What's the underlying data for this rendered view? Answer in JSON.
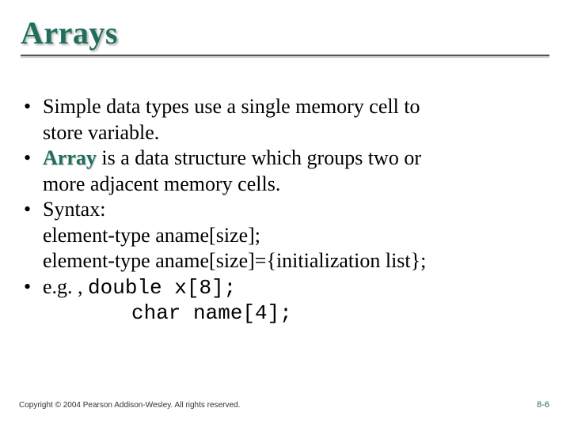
{
  "title": "Arrays",
  "bullets": [
    {
      "mark": "•",
      "line1": "Simple data types use a single memory cell to",
      "line2": "store variable."
    },
    {
      "mark": "•",
      "term": "Array",
      "line1_after": " is a data structure which groups two or",
      "line2": "more adjacent memory cells."
    },
    {
      "mark": "•",
      "line1": "Syntax:",
      "line2": "element-type aname[size];",
      "line3": "element-type aname[size]={initialization list};"
    },
    {
      "mark": "•",
      "prefix": "e.g. , ",
      "code1": "double x[8];",
      "code2": "char name[4];"
    }
  ],
  "footer": "Copyright © 2004 Pearson Addison-Wesley. All rights reserved.",
  "pagenum": "8-6"
}
